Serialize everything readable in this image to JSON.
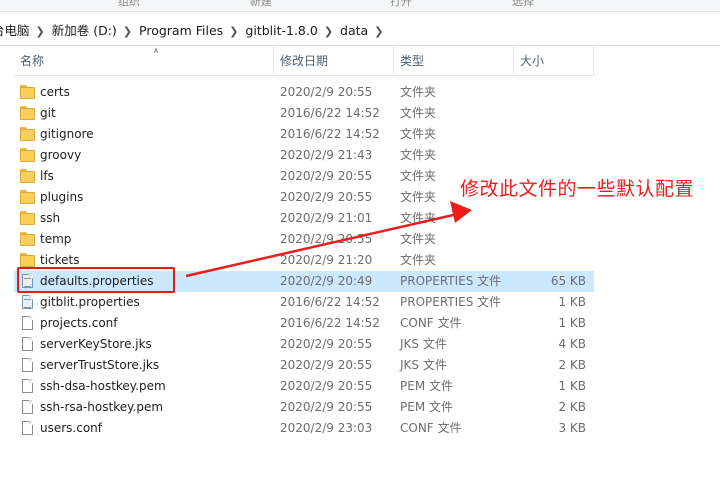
{
  "ribbon": {
    "labels": [
      "组织",
      "新建",
      "打开",
      "选择"
    ]
  },
  "breadcrumb": {
    "items": [
      "台电脑",
      "新加卷 (D:)",
      "Program Files",
      "gitblit-1.8.0",
      "data"
    ]
  },
  "columns": {
    "name": "名称",
    "date": "修改日期",
    "type": "类型",
    "size": "大小"
  },
  "files": [
    {
      "name": "certs",
      "date": "2020/2/9 20:55",
      "type": "文件夹",
      "size": "",
      "icon": "folder-icon"
    },
    {
      "name": "git",
      "date": "2016/6/22 14:52",
      "type": "文件夹",
      "size": "",
      "icon": "folder-icon"
    },
    {
      "name": "gitignore",
      "date": "2016/6/22 14:52",
      "type": "文件夹",
      "size": "",
      "icon": "folder-icon"
    },
    {
      "name": "groovy",
      "date": "2020/2/9 21:43",
      "type": "文件夹",
      "size": "",
      "icon": "folder-icon"
    },
    {
      "name": "lfs",
      "date": "2020/2/9 20:55",
      "type": "文件夹",
      "size": "",
      "icon": "folder-icon"
    },
    {
      "name": "plugins",
      "date": "2020/2/9 20:55",
      "type": "文件夹",
      "size": "",
      "icon": "folder-icon"
    },
    {
      "name": "ssh",
      "date": "2020/2/9 21:01",
      "type": "文件夹",
      "size": "",
      "icon": "folder-icon"
    },
    {
      "name": "temp",
      "date": "2020/2/9 20:55",
      "type": "文件夹",
      "size": "",
      "icon": "folder-icon"
    },
    {
      "name": "tickets",
      "date": "2020/2/9 21:20",
      "type": "文件夹",
      "size": "",
      "icon": "folder-icon"
    },
    {
      "name": "defaults.properties",
      "date": "2020/2/9 20:49",
      "type": "PROPERTIES 文件",
      "size": "65 KB",
      "icon": "properties-file-icon",
      "selected": true
    },
    {
      "name": "gitblit.properties",
      "date": "2016/6/22 14:52",
      "type": "PROPERTIES 文件",
      "size": "1 KB",
      "icon": "properties-file-icon"
    },
    {
      "name": "projects.conf",
      "date": "2016/6/22 14:52",
      "type": "CONF 文件",
      "size": "1 KB",
      "icon": "file-icon"
    },
    {
      "name": "serverKeyStore.jks",
      "date": "2020/2/9 20:55",
      "type": "JKS 文件",
      "size": "4 KB",
      "icon": "file-icon"
    },
    {
      "name": "serverTrustStore.jks",
      "date": "2020/2/9 20:55",
      "type": "JKS 文件",
      "size": "2 KB",
      "icon": "file-icon"
    },
    {
      "name": "ssh-dsa-hostkey.pem",
      "date": "2020/2/9 20:55",
      "type": "PEM 文件",
      "size": "1 KB",
      "icon": "file-icon"
    },
    {
      "name": "ssh-rsa-hostkey.pem",
      "date": "2020/2/9 20:55",
      "type": "PEM 文件",
      "size": "2 KB",
      "icon": "file-icon"
    },
    {
      "name": "users.conf",
      "date": "2020/2/9 23:03",
      "type": "CONF 文件",
      "size": "3 KB",
      "icon": "file-icon"
    }
  ],
  "annotation": {
    "text": "修改此文件的一些默认配置",
    "color": "#ee1c1c"
  },
  "colors": {
    "selection": "#cce8ff",
    "header_text": "#4c607a"
  }
}
